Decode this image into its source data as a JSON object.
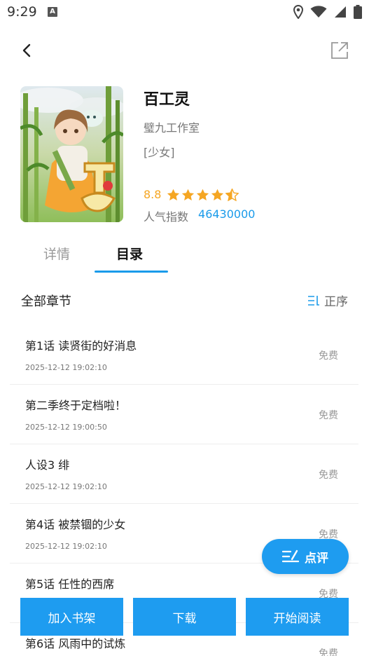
{
  "status_bar": {
    "time": "9:29",
    "notif_letter": "A"
  },
  "comic": {
    "title": "百工灵",
    "author": "璧九工作室",
    "tags": "[少女]",
    "rating": "8.8",
    "stars": 4.5,
    "popularity_label": "人气指数",
    "popularity_value": "46430000"
  },
  "tabs": {
    "details": "详情",
    "catalog": "目录"
  },
  "chapters_header": {
    "all": "全部章节",
    "sort": "正序"
  },
  "chapters": [
    {
      "title": "第1话 读贤街的好消息",
      "date": "2025-12-12 19:02:10",
      "price": "免费"
    },
    {
      "title": "第二季终于定档啦！",
      "date": "2025-12-12 19:00:50",
      "price": "免费"
    },
    {
      "title": "人设3 绯",
      "date": "2025-12-12 19:02:10",
      "price": "免费"
    },
    {
      "title": "第4话 被禁锢的少女",
      "date": "2025-12-12 19:02:10",
      "price": "免费"
    },
    {
      "title": "第5话 任性的西席",
      "date": "",
      "price": "免费"
    },
    {
      "title": "第6话 风雨中的试炼",
      "date": "",
      "price": "免费"
    }
  ],
  "review_button": "点评",
  "bottom": {
    "add_shelf": "加入书架",
    "download": "下载",
    "start_read": "开始阅读"
  },
  "colors": {
    "accent": "#1e9cf0",
    "rating": "#f5a623",
    "popularity": "#1a9bea"
  }
}
